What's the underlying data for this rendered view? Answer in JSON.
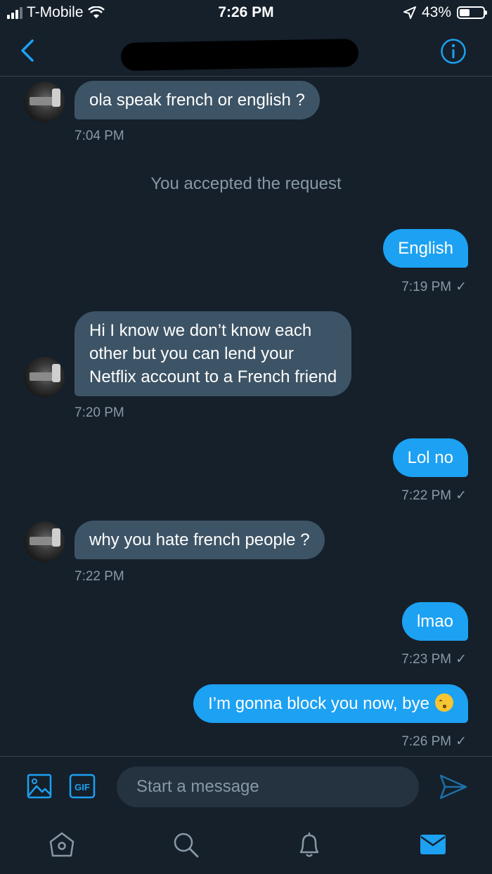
{
  "status_bar": {
    "carrier": "T-Mobile",
    "time": "7:26 PM",
    "battery": "43%",
    "battery_level": 0.43
  },
  "nav": {
    "back_icon": "chevron-left-icon",
    "info_icon": "info-icon"
  },
  "thread": {
    "m1": {
      "text": "ola speak french or english ?",
      "time": "7:04 PM"
    },
    "system_notice": "You accepted the request",
    "m2": {
      "text": "English",
      "time": "7:19 PM",
      "receipt": "✓"
    },
    "m3": {
      "lines": [
        "Hi I know we don’t know each",
        "other but you can lend your",
        "Netflix account to a French friend"
      ],
      "time": "7:20 PM"
    },
    "m4": {
      "text": "Lol no",
      "time": "7:22 PM",
      "receipt": "✓"
    },
    "m5": {
      "text": "why you hate french people ?",
      "time": "7:22 PM"
    },
    "m6": {
      "text": "lmao",
      "time": "7:23 PM",
      "receipt": "✓"
    },
    "m7": {
      "text": "I’m gonna block you now, bye",
      "emoji": "kissing-face-emoji",
      "time": "7:26 PM",
      "receipt": "✓"
    }
  },
  "compose": {
    "placeholder": "Start a message",
    "gif_label": "GIF"
  },
  "colors": {
    "background": "#15202b",
    "accent": "#1da1f2",
    "incoming_bubble": "#3d5466",
    "muted_text": "#8899a6"
  }
}
